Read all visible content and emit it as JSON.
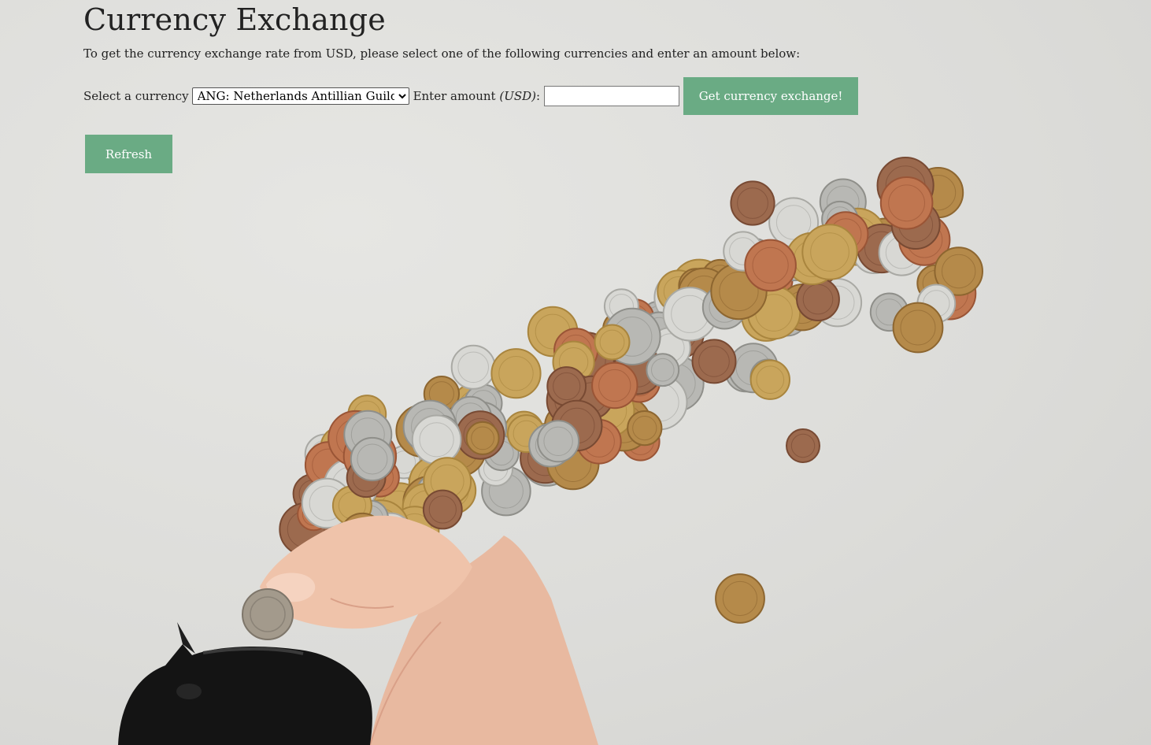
{
  "page": {
    "title": "Currency Exchange",
    "intro": "To get the currency exchange rate from USD, please select one of the following currencies and enter an amount below:"
  },
  "form": {
    "currency_label": "Select a currency",
    "currency_selected": "ANG: Netherlands Antillian Guilder",
    "amount_label_prefix": "Enter amount ",
    "amount_label_unit": "(USD)",
    "amount_label_suffix": ":",
    "amount_value": "",
    "submit_label": "Get currency exchange!"
  },
  "refresh_label": "Refresh",
  "colors": {
    "button": "#6aab84",
    "background": "#dcdcd9"
  },
  "background_image": {
    "icons": [
      "coins-pile-image",
      "hand-image",
      "piggy-bank-image"
    ]
  }
}
